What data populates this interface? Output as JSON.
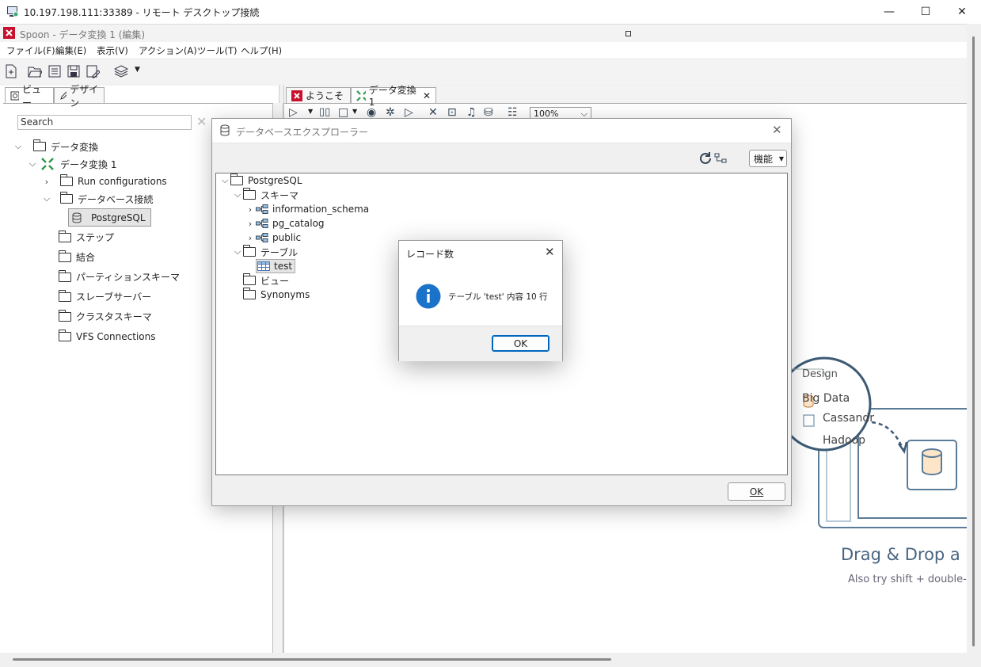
{
  "rdp": {
    "title": "10.197.198.111:33389 - リモート デスクトップ接続"
  },
  "app": {
    "title": "Spoon - データ変換 1 (編集)"
  },
  "menu": [
    "ファイル(F)",
    "編集(E)",
    "表示(V)",
    "アクション(A)",
    "ツール(T)",
    "ヘルプ(H)"
  ],
  "left": {
    "tabs": [
      "ビュー",
      "デザイン"
    ],
    "search_placeholder": "Search",
    "tree": {
      "root": "データ変換",
      "transform": "データ変換 1",
      "run_configs": "Run configurations",
      "db_conn": "データベース接続",
      "postgres": "PostgreSQL",
      "steps": "ステップ",
      "join": "結合",
      "partition": "パーティションスキーマ",
      "slave": "スレーブサーバー",
      "cluster": "クラスタスキーマ",
      "vfs": "VFS Connections"
    }
  },
  "editor": {
    "tabs": [
      "ようこそ",
      "データ変換 1"
    ],
    "zoom": "100%",
    "welcome": {
      "design_tab": "Design",
      "big_data": "Big Data",
      "cassandra": "Cassandr",
      "hadoop": "Hadoop",
      "headline": "Drag & Drop a S",
      "subline": "Also try shift + double-c"
    }
  },
  "db_explorer": {
    "title": "データベースエクスプローラー",
    "features_label": "機能",
    "ok_label": "OK",
    "tree": {
      "root": "PostgreSQL",
      "schemas_folder": "スキーマ",
      "schemas": [
        "information_schema",
        "pg_catalog",
        "public"
      ],
      "tables_folder": "テーブル",
      "table": "test",
      "views_folder": "ビュー",
      "synonyms_folder": "Synonyms"
    }
  },
  "record_dialog": {
    "title": "レコード数",
    "message": "テーブル 'test' 内容 10 行",
    "ok_label": "OK"
  }
}
